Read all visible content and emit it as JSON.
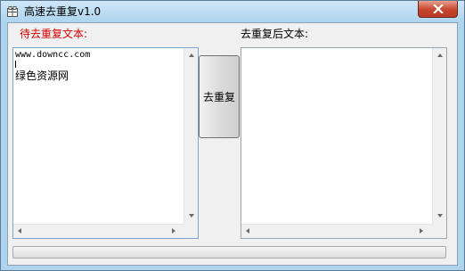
{
  "window": {
    "title": "高速去重复v1.0"
  },
  "source_panel": {
    "label": "待去重复文本:",
    "content_line1": "www.downcc.com",
    "content_line2": "绿色资源网"
  },
  "result_panel": {
    "label": "去重复后文本:",
    "content": ""
  },
  "actions": {
    "dedup_label": "去重复"
  },
  "progress": {
    "value": 0
  },
  "colors": {
    "source_label": "#d40000",
    "close_button": "#c7442d",
    "titlebar": "#aed4ee"
  }
}
